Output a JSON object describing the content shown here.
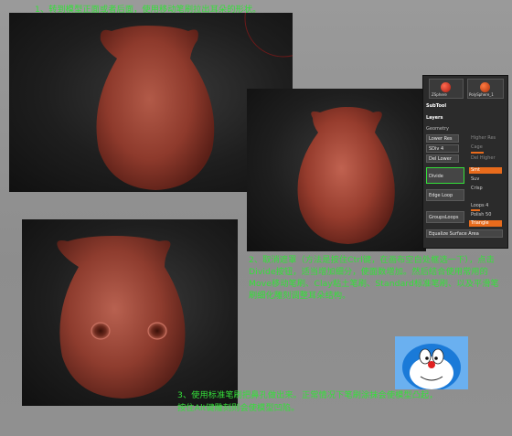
{
  "steps": {
    "step1": "1、转到模型正面或者后面，使用移动笔刷拉出耳朵的形状。",
    "step2": "2、取消遮罩（方法是按住Ctrl键，在画布空白处框选一下），点击Divide按钮，适当增加细分，使面数增加。然后结合使用常用的Move移动笔刷、Clay粘土笔刷、Standard标准笔刷、以及平滑笔刷细化雕刻调整耳朵结构。",
    "step3_line1": "3、使用标准笔刷把鼻孔做出来。正常情况下笔刷涂抹会使模型凸起，",
    "step3_line2": "按住Alt键雕刻则会使模型凹陷。"
  },
  "zbrush_panel": {
    "tool_thumbs": [
      "ZSphere",
      "PolySphere_1"
    ],
    "subtool_label": "SubTool",
    "layers_label": "Layers",
    "geometry_label": "Geometry",
    "lower_res": "Lower Res",
    "higher_res": "Higher Res",
    "sdiv_label": "SDiv 4",
    "cage_label": "Cage",
    "del_lower": "Del Lower",
    "del_higher": "Del Higher",
    "divide_label": "Divide",
    "smt_label": "Smt",
    "suv_label": "Suv",
    "crisp_label": "Crisp",
    "edge_loop": "Edge Loop",
    "groups_loops": "GroupsLoops",
    "loops_label": "Loops 4",
    "polish_label": "Polish 50",
    "triangle_label": "Triangle",
    "equalize_label": "Equalize Surface Area"
  }
}
